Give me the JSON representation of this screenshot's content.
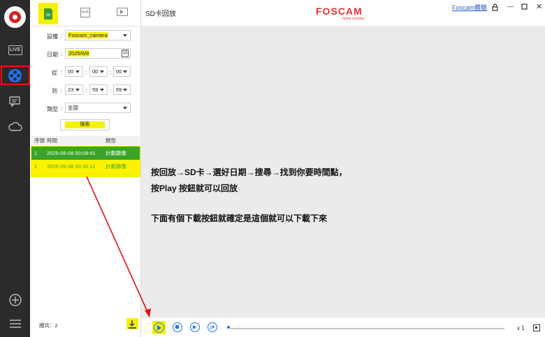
{
  "sidebar": {
    "icons": [
      "foscam-logo-icon",
      "live-tv-icon",
      "playback-reel-icon",
      "message-icon",
      "cloud-icon",
      "add-icon",
      "menu-icon"
    ],
    "live_label": "LIVE"
  },
  "panel": {
    "tabs": {
      "sd": "SD",
      "nvr": "NVR"
    },
    "device_label": "設備",
    "device_value": "Foscam_camera",
    "date_label": "日期",
    "date_value": "2025/6/8",
    "calendar_day": "15",
    "from_label": "從",
    "from_h": "00",
    "from_m": "00",
    "from_s": "00",
    "to_label": "到",
    "to_h": "23",
    "to_m": "59",
    "to_s": "59",
    "type_label": "類型",
    "type_value": "全部",
    "search_label": "搜索",
    "table_headers": {
      "seq": "序號",
      "time": "時間",
      "type": "類型"
    },
    "rows": [
      {
        "seq": "1",
        "time": "2025-06-08 00:09:41",
        "type": "計劃錄像"
      },
      {
        "seq": "2",
        "time": "2025-06-08 00:35:12",
        "type": "計劃錄像"
      }
    ],
    "total_label": "總共：2"
  },
  "header": {
    "title": "SD卡回放",
    "brand": "FOSCAM",
    "brand_sub": "home security",
    "experience_link": "Foscam體驗"
  },
  "content": {
    "line1": "按回放→SD卡→選好日期→搜尋→找到你要時間點，",
    "line2": "按Play 按鈕就可以回放",
    "line3": "下面有個下載按鈕就確定是這個就可以下載下來"
  },
  "player": {
    "speed_label": "x 1",
    "progress": 0.0
  },
  "colors": {
    "accent": "#1e73ff",
    "highlight": "#f5f100",
    "brand": "#e63131",
    "row_selected": "#3aa329",
    "annotation": "#e11111"
  }
}
